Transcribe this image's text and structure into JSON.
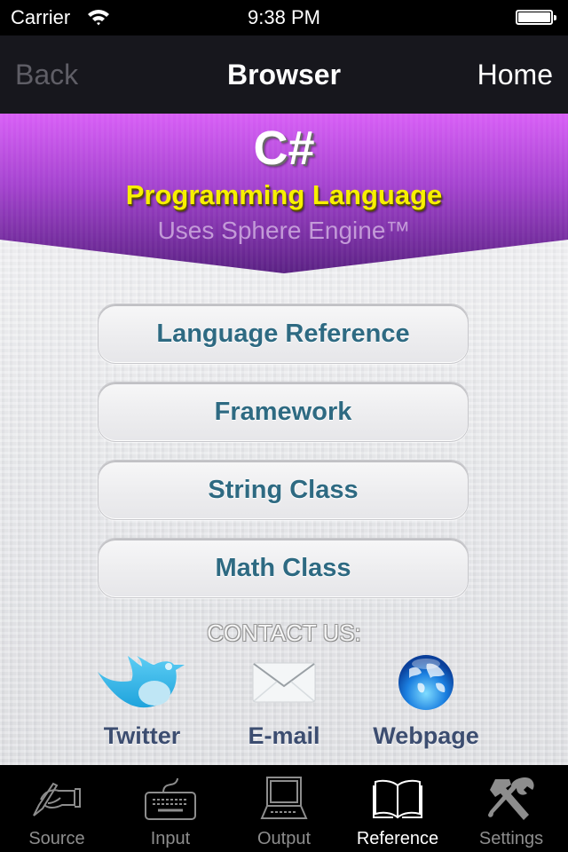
{
  "status_bar": {
    "carrier": "Carrier",
    "time": "9:38 PM",
    "wifi_icon": "wifi-icon",
    "battery_icon": "battery-full-icon"
  },
  "nav": {
    "back_label": "Back",
    "title": "Browser",
    "home_label": "Home"
  },
  "banner": {
    "title": "C#",
    "subtitle": "Programming Language",
    "tagline": "Uses Sphere Engine™"
  },
  "menu": {
    "items": [
      {
        "label": "Language Reference"
      },
      {
        "label": "Framework"
      },
      {
        "label": "String Class"
      },
      {
        "label": "Math Class"
      }
    ]
  },
  "contact": {
    "heading": "CONTACT US:",
    "items": [
      {
        "label": "Twitter",
        "icon": "twitter-bird-icon"
      },
      {
        "label": "E-mail",
        "icon": "envelope-icon"
      },
      {
        "label": "Webpage",
        "icon": "globe-icon"
      }
    ]
  },
  "tab_bar": {
    "active": "Reference",
    "tabs": [
      {
        "label": "Source",
        "icon": "hand-writing-icon"
      },
      {
        "label": "Input",
        "icon": "keyboard-icon"
      },
      {
        "label": "Output",
        "icon": "computer-terminal-icon"
      },
      {
        "label": "Reference",
        "icon": "open-book-icon"
      },
      {
        "label": "Settings",
        "icon": "hammer-wrench-icon"
      }
    ]
  },
  "colors": {
    "banner_purple_top": "#d75cf5",
    "banner_purple_bottom": "#5c2285",
    "subtitle_yellow": "#f7f000",
    "button_text": "#2e6a82",
    "contact_text": "#3c4d70"
  }
}
